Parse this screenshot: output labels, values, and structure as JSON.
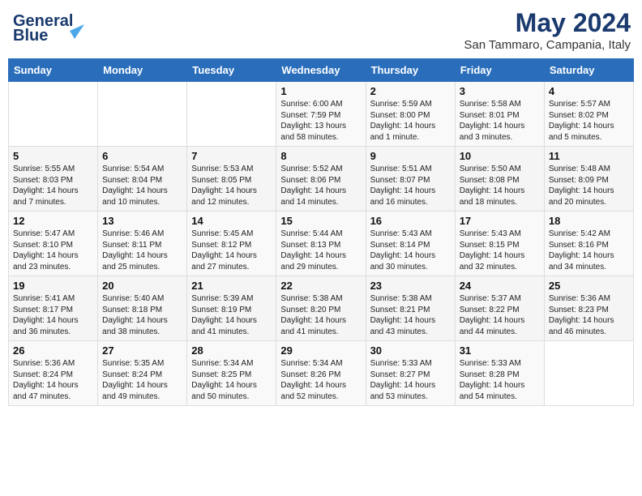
{
  "header": {
    "logo_line1": "General",
    "logo_line2": "Blue",
    "month": "May 2024",
    "location": "San Tammaro, Campania, Italy"
  },
  "weekdays": [
    "Sunday",
    "Monday",
    "Tuesday",
    "Wednesday",
    "Thursday",
    "Friday",
    "Saturday"
  ],
  "weeks": [
    [
      {
        "day": "",
        "info": ""
      },
      {
        "day": "",
        "info": ""
      },
      {
        "day": "",
        "info": ""
      },
      {
        "day": "1",
        "info": "Sunrise: 6:00 AM\nSunset: 7:59 PM\nDaylight: 13 hours\nand 58 minutes."
      },
      {
        "day": "2",
        "info": "Sunrise: 5:59 AM\nSunset: 8:00 PM\nDaylight: 14 hours\nand 1 minute."
      },
      {
        "day": "3",
        "info": "Sunrise: 5:58 AM\nSunset: 8:01 PM\nDaylight: 14 hours\nand 3 minutes."
      },
      {
        "day": "4",
        "info": "Sunrise: 5:57 AM\nSunset: 8:02 PM\nDaylight: 14 hours\nand 5 minutes."
      }
    ],
    [
      {
        "day": "5",
        "info": "Sunrise: 5:55 AM\nSunset: 8:03 PM\nDaylight: 14 hours\nand 7 minutes."
      },
      {
        "day": "6",
        "info": "Sunrise: 5:54 AM\nSunset: 8:04 PM\nDaylight: 14 hours\nand 10 minutes."
      },
      {
        "day": "7",
        "info": "Sunrise: 5:53 AM\nSunset: 8:05 PM\nDaylight: 14 hours\nand 12 minutes."
      },
      {
        "day": "8",
        "info": "Sunrise: 5:52 AM\nSunset: 8:06 PM\nDaylight: 14 hours\nand 14 minutes."
      },
      {
        "day": "9",
        "info": "Sunrise: 5:51 AM\nSunset: 8:07 PM\nDaylight: 14 hours\nand 16 minutes."
      },
      {
        "day": "10",
        "info": "Sunrise: 5:50 AM\nSunset: 8:08 PM\nDaylight: 14 hours\nand 18 minutes."
      },
      {
        "day": "11",
        "info": "Sunrise: 5:48 AM\nSunset: 8:09 PM\nDaylight: 14 hours\nand 20 minutes."
      }
    ],
    [
      {
        "day": "12",
        "info": "Sunrise: 5:47 AM\nSunset: 8:10 PM\nDaylight: 14 hours\nand 23 minutes."
      },
      {
        "day": "13",
        "info": "Sunrise: 5:46 AM\nSunset: 8:11 PM\nDaylight: 14 hours\nand 25 minutes."
      },
      {
        "day": "14",
        "info": "Sunrise: 5:45 AM\nSunset: 8:12 PM\nDaylight: 14 hours\nand 27 minutes."
      },
      {
        "day": "15",
        "info": "Sunrise: 5:44 AM\nSunset: 8:13 PM\nDaylight: 14 hours\nand 29 minutes."
      },
      {
        "day": "16",
        "info": "Sunrise: 5:43 AM\nSunset: 8:14 PM\nDaylight: 14 hours\nand 30 minutes."
      },
      {
        "day": "17",
        "info": "Sunrise: 5:43 AM\nSunset: 8:15 PM\nDaylight: 14 hours\nand 32 minutes."
      },
      {
        "day": "18",
        "info": "Sunrise: 5:42 AM\nSunset: 8:16 PM\nDaylight: 14 hours\nand 34 minutes."
      }
    ],
    [
      {
        "day": "19",
        "info": "Sunrise: 5:41 AM\nSunset: 8:17 PM\nDaylight: 14 hours\nand 36 minutes."
      },
      {
        "day": "20",
        "info": "Sunrise: 5:40 AM\nSunset: 8:18 PM\nDaylight: 14 hours\nand 38 minutes."
      },
      {
        "day": "21",
        "info": "Sunrise: 5:39 AM\nSunset: 8:19 PM\nDaylight: 14 hours\nand 41 minutes."
      },
      {
        "day": "22",
        "info": "Sunrise: 5:38 AM\nSunset: 8:20 PM\nDaylight: 14 hours\nand 41 minutes."
      },
      {
        "day": "23",
        "info": "Sunrise: 5:38 AM\nSunset: 8:21 PM\nDaylight: 14 hours\nand 43 minutes."
      },
      {
        "day": "24",
        "info": "Sunrise: 5:37 AM\nSunset: 8:22 PM\nDaylight: 14 hours\nand 44 minutes."
      },
      {
        "day": "25",
        "info": "Sunrise: 5:36 AM\nSunset: 8:23 PM\nDaylight: 14 hours\nand 46 minutes."
      }
    ],
    [
      {
        "day": "26",
        "info": "Sunrise: 5:36 AM\nSunset: 8:24 PM\nDaylight: 14 hours\nand 47 minutes."
      },
      {
        "day": "27",
        "info": "Sunrise: 5:35 AM\nSunset: 8:24 PM\nDaylight: 14 hours\nand 49 minutes."
      },
      {
        "day": "28",
        "info": "Sunrise: 5:34 AM\nSunset: 8:25 PM\nDaylight: 14 hours\nand 50 minutes."
      },
      {
        "day": "29",
        "info": "Sunrise: 5:34 AM\nSunset: 8:26 PM\nDaylight: 14 hours\nand 52 minutes."
      },
      {
        "day": "30",
        "info": "Sunrise: 5:33 AM\nSunset: 8:27 PM\nDaylight: 14 hours\nand 53 minutes."
      },
      {
        "day": "31",
        "info": "Sunrise: 5:33 AM\nSunset: 8:28 PM\nDaylight: 14 hours\nand 54 minutes."
      },
      {
        "day": "",
        "info": ""
      }
    ]
  ]
}
